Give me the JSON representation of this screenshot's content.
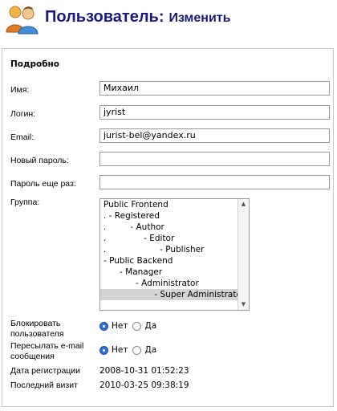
{
  "header": {
    "title": "Пользователь:",
    "action": "Изменить"
  },
  "panel": {
    "legend": "Подробно"
  },
  "fields": {
    "name": {
      "label": "Имя:",
      "value": "Михаил"
    },
    "login": {
      "label": "Логин:",
      "value": "jyrist"
    },
    "email": {
      "label": "Email:",
      "value": "jurist-bel@yandex.ru"
    },
    "new_password": {
      "label": "Новый пароль:",
      "value": ""
    },
    "password_again": {
      "label": "Пароль еще раз:",
      "value": ""
    }
  },
  "group": {
    "label": "Группа:",
    "options": [
      {
        "text": "Public Frontend",
        "selected": false
      },
      {
        "text": ". - Registered",
        "selected": false
      },
      {
        "text": ".         - Author",
        "selected": false
      },
      {
        "text": ".              - Editor",
        "selected": false
      },
      {
        "text": ".                    - Publisher",
        "selected": false
      },
      {
        "text": "- Public Backend",
        "selected": false
      },
      {
        "text": "      - Manager",
        "selected": false
      },
      {
        "text": "            - Administrator",
        "selected": false
      },
      {
        "text": "                   - Super Administrator",
        "selected": true
      }
    ]
  },
  "block_user": {
    "label_line1": "Блокировать",
    "label_line2": "пользователя",
    "option_no": "Нет",
    "option_yes": "Да",
    "selected": "no"
  },
  "send_email": {
    "label_line1": "Пересылать e-mail",
    "label_line2": "сообщения",
    "option_no": "Нет",
    "option_yes": "Да",
    "selected": "no"
  },
  "registration": {
    "label": "Дата регистрации",
    "value": "2008-10-31 01:52:23"
  },
  "last_visit": {
    "label": "Последний визит",
    "value": "2010-03-25 09:38:19"
  },
  "icons": {
    "header": "users-icon"
  },
  "colors": {
    "title": "#1a1a7a",
    "radio_checked": "#2b6fd6"
  }
}
